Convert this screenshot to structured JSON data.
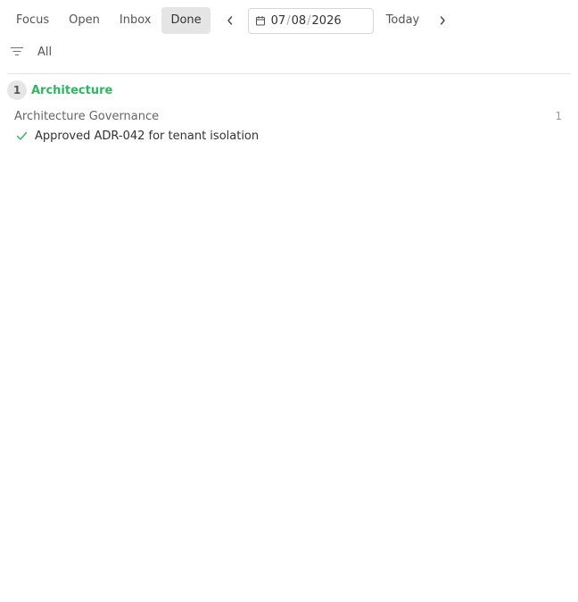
{
  "toolbar": {
    "tabs": [
      {
        "label": "Focus"
      },
      {
        "label": "Open"
      },
      {
        "label": "Inbox"
      },
      {
        "label": "Done"
      }
    ],
    "active_tab": "Done",
    "date": {
      "month": "07",
      "day": "08",
      "year": "2026",
      "separator": "/"
    },
    "today_label": "Today"
  },
  "filter": {
    "label": "All"
  },
  "groups": [
    {
      "count": "1",
      "title": "Architecture",
      "color": "#2db760",
      "subgroups": [
        {
          "name": "Architecture Governance",
          "count": "1",
          "tasks": [
            {
              "title": "Approved ADR-042 for tenant isolation",
              "status": "done"
            }
          ]
        }
      ]
    }
  ],
  "icons": {
    "prev": "chevron-left-icon",
    "next": "chevron-right-icon",
    "calendar": "calendar-icon",
    "filter": "filter-icon",
    "task_status": "check-icon"
  }
}
